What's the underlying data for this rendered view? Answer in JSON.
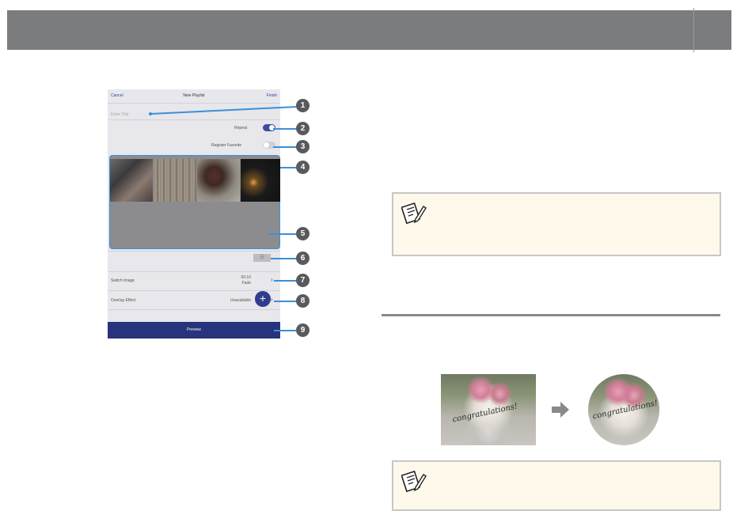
{
  "phone": {
    "cancel_label": "Cancel",
    "screen_title": "New Playlist",
    "finish_label": "Finish",
    "title_placeholder": "Enter Title",
    "repeat_label": "Repeat",
    "repeat_on": true,
    "register_favorite_label": "Register Favorite",
    "register_favorite_on": false,
    "switch_image_label": "Switch Image",
    "switch_image_value_1": "00:10",
    "switch_image_value_2": "Fade",
    "overlay_effect_label": "Overlay Effect",
    "overlay_effect_value": "Unavailable",
    "preview_label": "Preview",
    "add_icon": "plus-icon",
    "sort_icon": "list-icon"
  },
  "callouts": [
    "1",
    "2",
    "3",
    "4",
    "5",
    "6",
    "7",
    "8",
    "9"
  ],
  "flower": {
    "caption_text": "congratulations!",
    "arrow_icon": "right-arrow-icon"
  },
  "notes": {
    "icon": "memo-pencil-icon"
  },
  "colors": {
    "accent": "#3b8fd8",
    "header": "#7b7c7e",
    "preview_bar": "#27337a",
    "note_bg": "#fef9ea"
  }
}
